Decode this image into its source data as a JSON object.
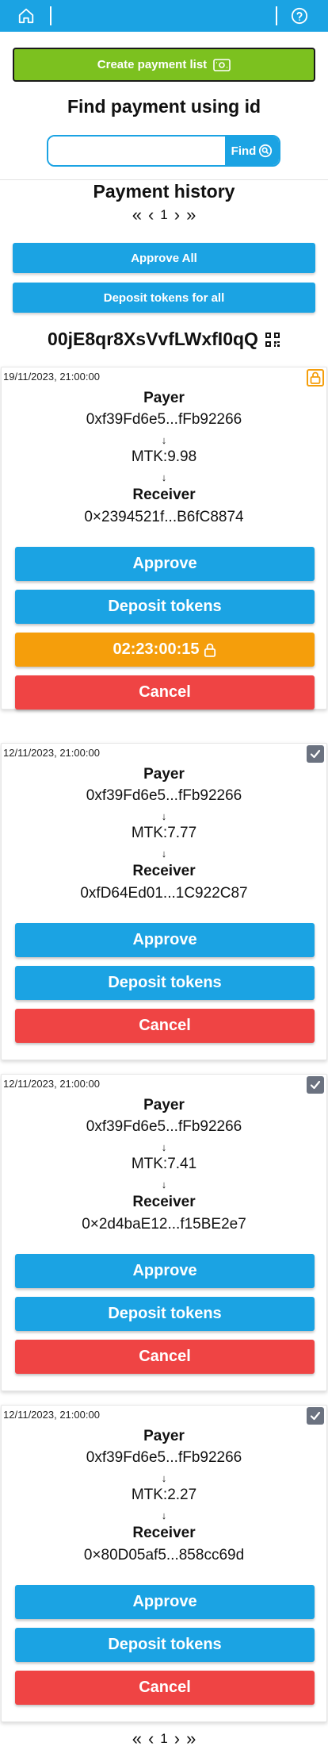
{
  "colors": {
    "accent": "#1ba3e3",
    "green": "#7cc11f",
    "orange": "#f59e0b",
    "red": "#ef4444",
    "grey": "#6b7280"
  },
  "header": {
    "home_icon": "home-icon",
    "help_icon": "help-circle-icon"
  },
  "create": {
    "label": "Create payment list",
    "icon": "payment-card-icon"
  },
  "find": {
    "title": "Find payment using id",
    "input_value": "",
    "placeholder": "",
    "button_label": "Find",
    "icon": "search-icon"
  },
  "history": {
    "title": "Payment history",
    "page": "1",
    "approve_all": "Approve All",
    "deposit_all": "Deposit tokens for all"
  },
  "account": {
    "id": "00jE8qr8XsVvfLWxfI0qQ",
    "icon": "qr-code-icon"
  },
  "labels": {
    "payer": "Payer",
    "receiver": "Receiver",
    "approve": "Approve",
    "deposit": "Deposit tokens",
    "cancel": "Cancel",
    "arrow": "↓"
  },
  "payments": [
    {
      "date": "19/11/2023, 21:00:00",
      "status": "locked",
      "payer": "0xf39Fd6e5...fFb92266",
      "amount": "MTK:9.98",
      "receiver": "0×2394521f...B6fC8874",
      "timer": "02:23:00:15"
    },
    {
      "date": "12/11/2023, 21:00:00",
      "status": "checked",
      "payer": "0xf39Fd6e5...fFb92266",
      "amount": "MTK:7.77",
      "receiver": "0xfD64Ed01...1C922C87"
    },
    {
      "date": "12/11/2023, 21:00:00",
      "status": "checked",
      "payer": "0xf39Fd6e5...fFb92266",
      "amount": "MTK:7.41",
      "receiver": "0×2d4baE12...f15BE2e7"
    },
    {
      "date": "12/11/2023, 21:00:00",
      "status": "checked",
      "payer": "0xf39Fd6e5...fFb92266",
      "amount": "MTK:2.27",
      "receiver": "0×80D05af5...858cc69d"
    }
  ]
}
